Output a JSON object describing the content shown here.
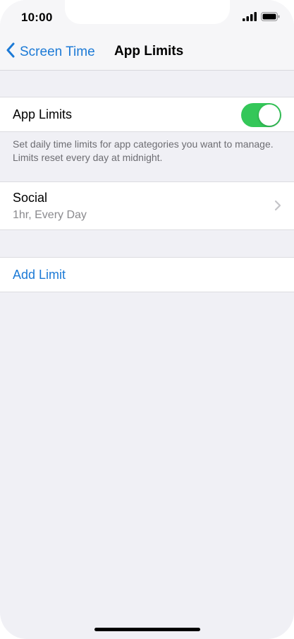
{
  "status_bar": {
    "time": "10:00"
  },
  "nav": {
    "back_label": "Screen Time",
    "title": "App Limits"
  },
  "app_limits_section": {
    "label": "App Limits",
    "toggle_on": true,
    "footer": "Set daily time limits for app categories you want to manage. Limits reset every day at midnight."
  },
  "limits": [
    {
      "title": "Social",
      "subtitle": "1hr, Every Day"
    }
  ],
  "add_limit_label": "Add Limit",
  "colors": {
    "accent": "#1c7ad6",
    "toggle_on": "#34c759",
    "background": "#f0f0f5"
  },
  "icons": {
    "signal": "cellular-signal-icon",
    "battery": "battery-icon",
    "back": "chevron-left-icon",
    "row_chevron": "chevron-right-icon"
  }
}
